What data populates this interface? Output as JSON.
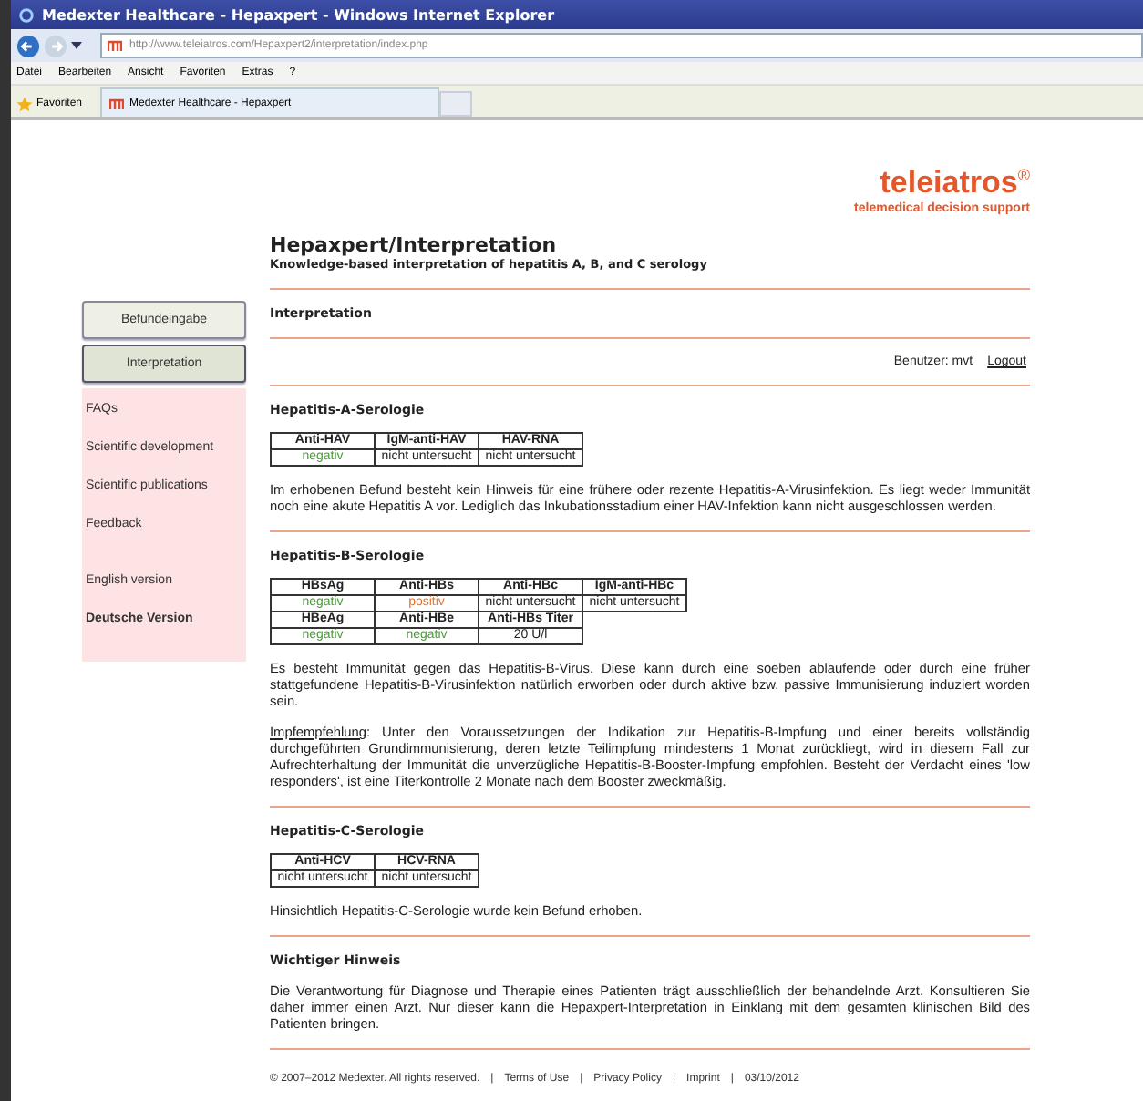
{
  "browser": {
    "title": "Medexter Healthcare - Hepaxpert - Windows Internet Explorer",
    "address": "http://www.teleiatros.com/Hepaxpert2/interpretation/index.php",
    "menu": [
      "Datei",
      "Bearbeiten",
      "Ansicht",
      "Favoriten",
      "Extras",
      "?"
    ],
    "favorites": "Favoriten",
    "tab": "Medexter Healthcare - Hepaxpert"
  },
  "logo": {
    "name": "teleiatros",
    "mark": "®",
    "tagline": "telemedical decision support"
  },
  "heading": "Hepaxpert/Interpretation",
  "subheading": "Knowledge-based interpretation of hepatitis A, B, and C serology",
  "nav_buttons": [
    {
      "label": "Befundeingabe",
      "selected": false
    },
    {
      "label": "Interpretation",
      "selected": true
    }
  ],
  "sidebar_links": [
    {
      "label": "FAQs",
      "selected": false
    },
    {
      "label": "Scientific development",
      "selected": false
    },
    {
      "label": "Scientific publications",
      "selected": false
    },
    {
      "label": "Feedback",
      "selected": false
    },
    {
      "label": "English version",
      "selected": false
    },
    {
      "label": "Deutsche Version",
      "selected": true
    }
  ],
  "section_title": "Interpretation",
  "user": "Benutzer: mvt",
  "logout": "Logout",
  "sections": [
    {
      "title": "Hepatitis-A-Serologie",
      "rows": [
        {
          "kind": "header",
          "cells": [
            {
              "text": "Anti-HAV"
            },
            {
              "text": "IgM-anti-HAV"
            },
            {
              "text": "HAV-RNA"
            }
          ]
        },
        {
          "kind": "result",
          "cells": [
            {
              "text": "negativ",
              "color": "#4c9a3a"
            },
            {
              "text": "nicht untersucht",
              "color": "#222222"
            },
            {
              "text": "nicht untersucht",
              "color": "#222222"
            }
          ]
        }
      ],
      "paragraphs": [
        {
          "text": "Im erhobenen Befund besteht kein Hinweis für eine frühere oder rezente Hepatitis-A-Virusinfektion. Es liegt weder Immunität noch eine akute Hepatitis A vor. Lediglich das Inkubationsstadium einer HAV-Infektion kann nicht ausgeschlossen werden."
        }
      ]
    },
    {
      "title": "Hepatitis-B-Serologie",
      "rows": [
        {
          "kind": "header",
          "cells": [
            {
              "text": "HBsAg"
            },
            {
              "text": "Anti-HBs"
            },
            {
              "text": "Anti-HBc"
            },
            {
              "text": "IgM-anti-HBc"
            }
          ]
        },
        {
          "kind": "result",
          "cells": [
            {
              "text": "negativ",
              "color": "#4c9a3a"
            },
            {
              "text": "positiv",
              "color": "#e8742e"
            },
            {
              "text": "nicht untersucht",
              "color": "#222222"
            },
            {
              "text": "nicht untersucht",
              "color": "#222222"
            }
          ]
        },
        {
          "kind": "header",
          "cells": [
            {
              "text": "HBeAg"
            },
            {
              "text": "Anti-HBe"
            },
            {
              "text": "Anti-HBs Titer"
            }
          ]
        },
        {
          "kind": "result",
          "cells": [
            {
              "text": "negativ",
              "color": "#4c9a3a"
            },
            {
              "text": "negativ",
              "color": "#4c9a3a"
            },
            {
              "text": "20 U/l",
              "color": "#222222"
            }
          ]
        }
      ],
      "paragraphs": [
        {
          "text": "Es besteht Immunität gegen das Hepatitis-B-Virus. Diese kann durch eine soeben ablaufende oder durch eine früher stattgefundene Hepatitis-B-Virusinfektion natürlich erworben oder durch aktive bzw. passive Immunisierung induziert worden sein."
        },
        {
          "link": "Impfempfehlung",
          "text": ": Unter den Voraussetzungen der Indikation zur Hepatitis-B-Impfung und einer bereits vollständig durchgeführten Grundimmunisierung, deren letzte Teilimpfung mindestens 1 Monat zurückliegt, wird in diesem Fall zur Aufrechterhaltung der Immunität die unverzügliche Hepatitis-B-Booster-Impfung empfohlen. Besteht der Verdacht eines 'low responders', ist eine Titerkontrolle 2 Monate nach dem Booster zweckmäßig."
        }
      ]
    },
    {
      "title": "Hepatitis-C-Serologie",
      "rows": [
        {
          "kind": "header",
          "cells": [
            {
              "text": "Anti-HCV"
            },
            {
              "text": "HCV-RNA"
            }
          ]
        },
        {
          "kind": "result",
          "cells": [
            {
              "text": "nicht untersucht",
              "color": "#222222"
            },
            {
              "text": "nicht untersucht",
              "color": "#222222"
            }
          ]
        }
      ],
      "paragraphs": [
        {
          "text": "Hinsichtlich Hepatitis-C-Serologie wurde kein Befund erhoben."
        }
      ]
    },
    {
      "title": "Wichtiger Hinweis",
      "paragraphs": [
        {
          "text": "Die Verantwortung für Diagnose und Therapie eines Patienten trägt ausschließlich der behandelnde Arzt. Konsultieren Sie daher immer einen Arzt. Nur dieser kann die Hepaxpert-Interpretation in Einklang mit dem gesamten klinischen Bild des Patienten bringen."
        }
      ]
    }
  ],
  "footer": {
    "copyright": "© 2007–2012 Medexter. All rights reserved.",
    "separator": "|",
    "links": [
      "Terms of Use",
      "Privacy Policy",
      "Imprint"
    ],
    "date": "03/10/2012"
  }
}
